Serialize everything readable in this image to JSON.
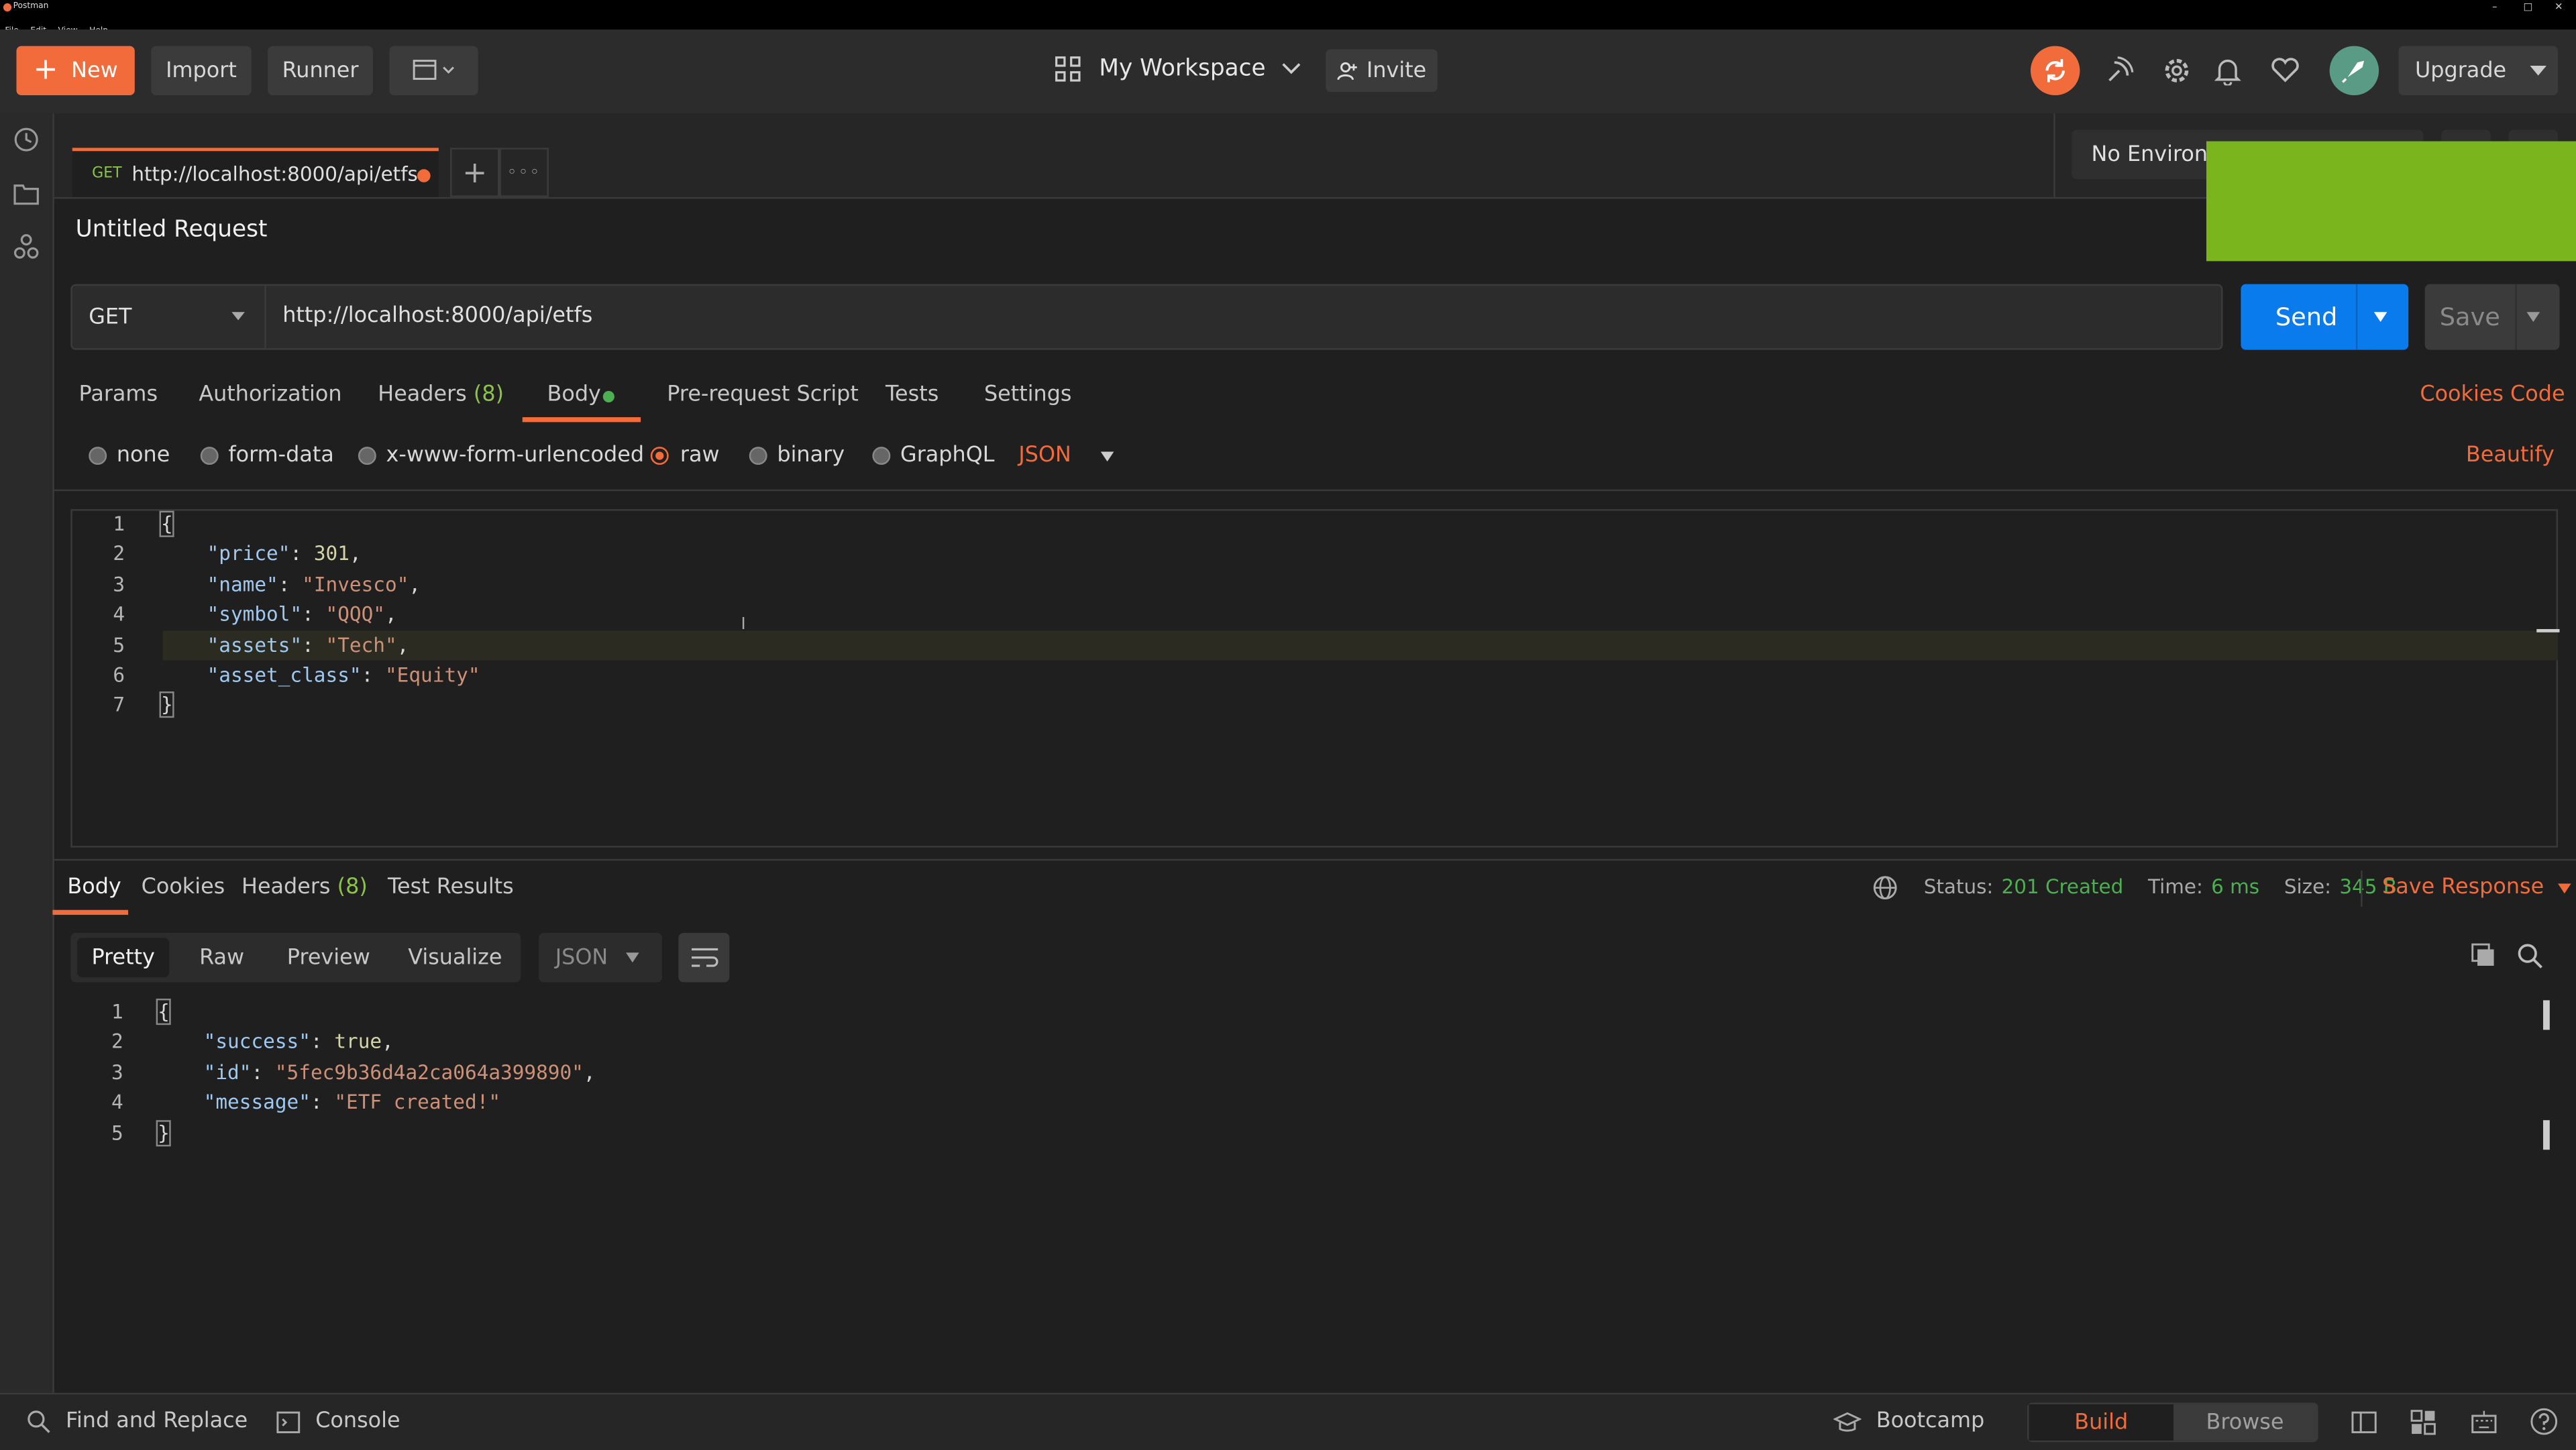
{
  "window": {
    "title": "Postman",
    "min": "–",
    "max": "□",
    "close": "✕"
  },
  "menu": [
    "File",
    "Edit",
    "View",
    "Help"
  ],
  "header": {
    "new_label": "New",
    "import_label": "Import",
    "runner_label": "Runner",
    "workspace_label": "My Workspace",
    "invite_label": "Invite",
    "upgrade_label": "Upgrade"
  },
  "tabs": {
    "active": {
      "method": "GET",
      "url": "http://localhost:8000/api/etfs"
    },
    "environment": "No Environm"
  },
  "request": {
    "title": "Untitled Request",
    "method": "GET",
    "url": "http://localhost:8000/api/etfs",
    "send_label": "Send",
    "save_label": "Save",
    "tabs": [
      "Params",
      "Authorization",
      "Headers",
      "Body",
      "Pre-request Script",
      "Tests",
      "Settings"
    ],
    "headers_count": "(8)",
    "cookies_label": "Cookies",
    "code_label": "Code",
    "body_modes": [
      "none",
      "form-data",
      "x-www-form-urlencoded",
      "raw",
      "binary",
      "GraphQL"
    ],
    "format": "JSON",
    "beautify_label": "Beautify",
    "body_lines": [
      {
        "n": "1",
        "text": "{"
      },
      {
        "n": "2",
        "key": "\"price\"",
        "val": "301",
        "type": "num"
      },
      {
        "n": "3",
        "key": "\"name\"",
        "val": "\"Invesco\"",
        "type": "str"
      },
      {
        "n": "4",
        "key": "\"symbol\"",
        "val": "\"QQQ\"",
        "type": "str"
      },
      {
        "n": "5",
        "key": "\"assets\"",
        "val": "\"Tech\"",
        "type": "str"
      },
      {
        "n": "6",
        "key": "\"asset_class\"",
        "val": "\"Equity\"",
        "type": "str",
        "last": true
      },
      {
        "n": "7",
        "text": "}"
      }
    ]
  },
  "response": {
    "tabs": [
      "Body",
      "Cookies",
      "Headers",
      "Test Results"
    ],
    "headers_count": "(8)",
    "status_label": "Status:",
    "status_value": "201 Created",
    "time_label": "Time:",
    "time_value": "6 ms",
    "size_label": "Size:",
    "size_value": "345 B",
    "save_response_label": "Save Response",
    "view_modes": [
      "Pretty",
      "Raw",
      "Preview",
      "Visualize"
    ],
    "format": "JSON",
    "body_lines": [
      {
        "n": "1",
        "text": "{"
      },
      {
        "n": "2",
        "key": "\"success\"",
        "val": "true",
        "type": "bool"
      },
      {
        "n": "3",
        "key": "\"id\"",
        "val": "\"5fec9b36d4a2ca064a399890\"",
        "type": "str"
      },
      {
        "n": "4",
        "key": "\"message\"",
        "val": "\"ETF created!\"",
        "type": "str",
        "last": true
      },
      {
        "n": "5",
        "text": "}"
      }
    ]
  },
  "footer": {
    "find_replace": "Find and Replace",
    "console": "Console",
    "bootcamp": "Bootcamp",
    "build": "Build",
    "browse": "Browse"
  },
  "colors": {
    "accent": "#f26b3a",
    "send_blue": "#097bed",
    "status_green": "#4caf50",
    "overlay_green": "#7ab51d"
  }
}
